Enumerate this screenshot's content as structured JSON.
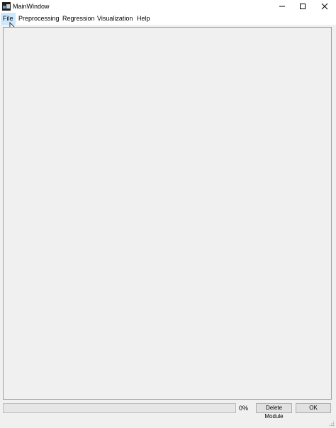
{
  "window": {
    "title": "MainWindow",
    "controls": [
      "minimize-icon",
      "maximize-icon",
      "close-icon"
    ]
  },
  "menu": {
    "items": [
      {
        "label": "File",
        "active": true
      },
      {
        "label": "Preprocessing"
      },
      {
        "label": "Regression"
      },
      {
        "label": "Visualization"
      },
      {
        "label": "Help"
      }
    ]
  },
  "status": {
    "progress": 0,
    "progress_text": "0%",
    "delete_label": "Delete Module",
    "ok_label": "OK"
  },
  "colors": {
    "background": "#f0f0f0",
    "menu_highlight": "#cce8ff",
    "border": "#a0a0a0"
  }
}
